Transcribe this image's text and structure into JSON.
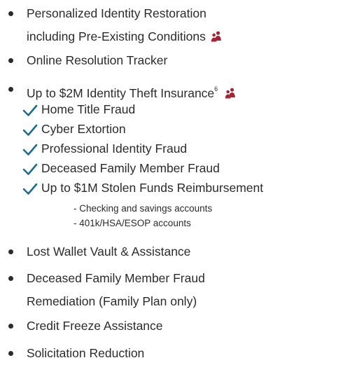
{
  "colors": {
    "text": "#2b2b2b",
    "check": "#1c6d8f",
    "family_icon": "#a32638"
  },
  "icons": {
    "family": "family-icon",
    "check": "checkmark-icon"
  },
  "items": [
    {
      "lines": [
        "Personalized Identity Restoration",
        "including Pre-Existing Conditions"
      ],
      "family_icon": true
    },
    {
      "lines": [
        "Online Resolution Tracker"
      ]
    },
    {
      "lines": [
        "Up to $2M Identity Theft Insurance"
      ],
      "superscript": "6",
      "family_icon": true
    },
    {
      "lines": [
        "Lost Wallet Vault & Assistance"
      ]
    },
    {
      "lines": [
        "Deceased Family Member Fraud",
        "Remediation (Family Plan only)"
      ]
    },
    {
      "lines": [
        "Credit Freeze Assistance"
      ]
    },
    {
      "lines": [
        "Solicitation Reduction"
      ]
    }
  ],
  "insurance_subitems": [
    "Home Title Fraud",
    "Cyber Extortion",
    "Professional Identity Fraud",
    "Deceased Family Member Fraud",
    "Up to $1M Stolen Funds Reimbursement"
  ],
  "stolen_funds_details": [
    "- Checking and savings accounts",
    "- 401k/HSA/ESOP accounts"
  ]
}
